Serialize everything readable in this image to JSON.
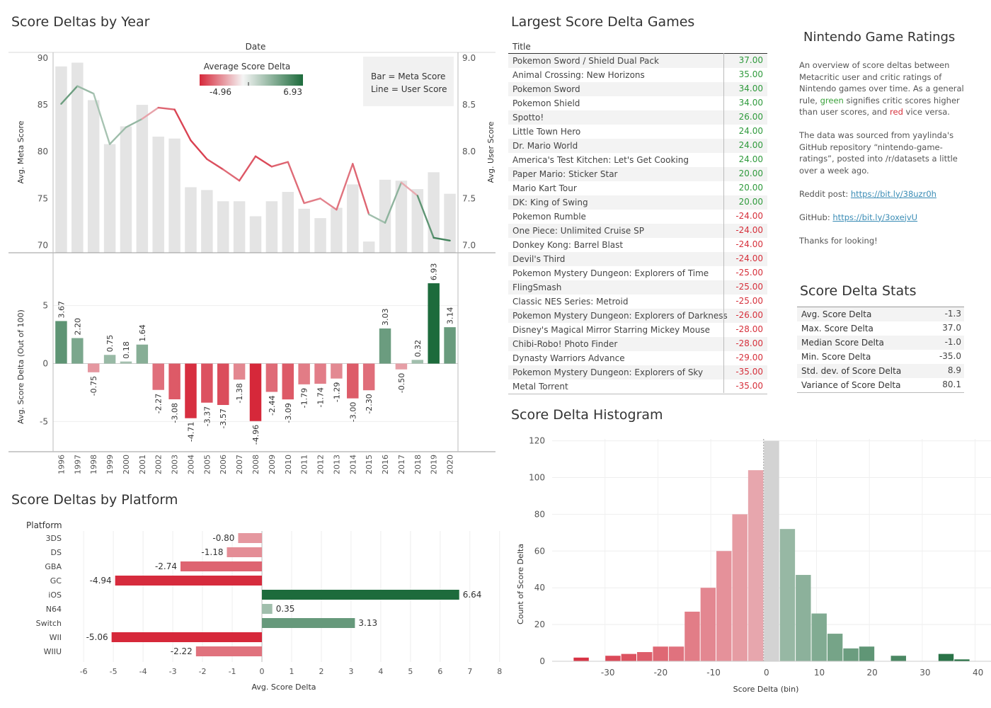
{
  "app": {
    "title": "Nintendo Game Ratings",
    "intro": {
      "p1_a": "An overview of score deltas between Metacritic user and critic ratings of Nintendo games over time. As a general rule, ",
      "p1_green": "green",
      "p1_b": " signifies critic scores higher than user scores, and ",
      "p1_red": "red",
      "p1_c": " vice versa.",
      "p2": "The data was sourced from yaylinda's GitHub repository “nintendo-game-ratings”, posted into /r/datasets a little over a week ago.",
      "reddit_label": "Reddit post: ",
      "reddit_link": "https://bit.ly/38uzr0h",
      "github_label": "GitHub: ",
      "github_link": "https://bit.ly/3oxejvU",
      "thanks": "Thanks for looking!"
    }
  },
  "titles": {
    "by_year": "Score Deltas by Year",
    "largest": "Largest Score Delta Games",
    "stats": "Score Delta Stats",
    "by_platform": "Score Deltas by Platform",
    "histogram": "Score Delta Histogram"
  },
  "colors": {
    "neg_max": "#d6283a",
    "neutral": "#f2f2f2",
    "pos_max": "#1d6b3c",
    "bar_gray": "#e4e4e4",
    "link": "#3a8cb5"
  },
  "games": {
    "header": "Title",
    "rows": [
      {
        "title": "Pokemon Sword / Shield Dual Pack",
        "value": "37.00"
      },
      {
        "title": "Animal Crossing: New Horizons",
        "value": "35.00"
      },
      {
        "title": "Pokemon Sword",
        "value": "34.00"
      },
      {
        "title": "Pokemon Shield",
        "value": "34.00"
      },
      {
        "title": "Spotto!",
        "value": "26.00"
      },
      {
        "title": "Little Town Hero",
        "value": "24.00"
      },
      {
        "title": "Dr. Mario World",
        "value": "24.00"
      },
      {
        "title": "America's Test Kitchen: Let's Get Cooking",
        "value": "24.00"
      },
      {
        "title": "Paper Mario: Sticker Star",
        "value": "20.00"
      },
      {
        "title": "Mario Kart Tour",
        "value": "20.00"
      },
      {
        "title": "DK: King of Swing",
        "value": "20.00"
      },
      {
        "title": "Pokemon Rumble",
        "value": "-24.00"
      },
      {
        "title": "One Piece: Unlimited Cruise SP",
        "value": "-24.00"
      },
      {
        "title": "Donkey Kong: Barrel Blast",
        "value": "-24.00"
      },
      {
        "title": "Devil's Third",
        "value": "-24.00"
      },
      {
        "title": "Pokemon Mystery Dungeon: Explorers of Time",
        "value": "-25.00"
      },
      {
        "title": "FlingSmash",
        "value": "-25.00"
      },
      {
        "title": "Classic NES Series: Metroid",
        "value": "-25.00"
      },
      {
        "title": "Pokemon Mystery Dungeon: Explorers of Darkness",
        "value": "-26.00"
      },
      {
        "title": "Disney's Magical Mirror Starring Mickey Mouse",
        "value": "-28.00"
      },
      {
        "title": "Chibi-Robo! Photo Finder",
        "value": "-28.00"
      },
      {
        "title": "Dynasty Warriors Advance",
        "value": "-29.00"
      },
      {
        "title": "Pokemon Mystery Dungeon: Explorers of Sky",
        "value": "-35.00"
      },
      {
        "title": "Metal Torrent",
        "value": "-35.00"
      }
    ]
  },
  "stats": {
    "rows": [
      {
        "label": "Avg. Score Delta",
        "value": "-1.3"
      },
      {
        "label": "Max. Score Delta",
        "value": "37.0"
      },
      {
        "label": "Median Score Delta",
        "value": "-1.0"
      },
      {
        "label": "Min. Score Delta",
        "value": "-35.0"
      },
      {
        "label": "Std. dev. of Score Delta",
        "value": "8.9"
      },
      {
        "label": "Variance of Score Delta",
        "value": "80.1"
      }
    ]
  },
  "chart_data": [
    {
      "id": "year_combo",
      "type": "bar",
      "title": "Score Deltas by Year",
      "header": "Date",
      "x": [
        "1996",
        "1997",
        "1998",
        "1999",
        "2000",
        "2001",
        "2002",
        "2003",
        "2004",
        "2005",
        "2006",
        "2007",
        "2008",
        "2009",
        "2010",
        "2011",
        "2012",
        "2013",
        "2014",
        "2015",
        "2016",
        "2017",
        "2018",
        "2019",
        "2020"
      ],
      "series": [
        {
          "name": "Meta Score",
          "axis": "left",
          "values": [
            89.1,
            89.5,
            85.5,
            80.8,
            82.7,
            85.0,
            81.6,
            81.4,
            76.2,
            75.9,
            74.7,
            74.7,
            73.1,
            74.7,
            75.7,
            73.9,
            72.9,
            74.0,
            76.5,
            70.4,
            77.0,
            76.9,
            76.0,
            77.8,
            75.5
          ]
        },
        {
          "name": "User Score",
          "axis": "right",
          "type": "line",
          "values": [
            8.51,
            8.7,
            8.62,
            8.08,
            8.26,
            8.35,
            8.47,
            8.45,
            8.12,
            7.92,
            7.81,
            7.69,
            7.95,
            7.84,
            7.89,
            7.45,
            7.5,
            7.38,
            7.87,
            7.33,
            7.24,
            7.67,
            7.53,
            7.08,
            7.05
          ]
        }
      ],
      "y_left": {
        "label": "Avg. Meta Score",
        "range": [
          69.2,
          90.6
        ],
        "ticks": [
          70,
          75,
          80,
          85,
          90
        ]
      },
      "y_right": {
        "label": "Avg. User Score",
        "range": [
          6.92,
          9.06
        ],
        "ticks": [
          "7.0",
          "7.5",
          "8.0",
          "8.5",
          "9.0"
        ]
      },
      "legend_title": "Average Score Delta",
      "legend_min": "-4.96",
      "legend_max": "6.93",
      "note_line1": "Bar = Meta Score",
      "note_line2": "Line = User Score"
    },
    {
      "id": "year_delta",
      "type": "bar",
      "x": [
        "1996",
        "1997",
        "1998",
        "1999",
        "2000",
        "2001",
        "2002",
        "2003",
        "2004",
        "2005",
        "2006",
        "2007",
        "2008",
        "2009",
        "2010",
        "2011",
        "2012",
        "2013",
        "2014",
        "2015",
        "2016",
        "2017",
        "2018",
        "2019",
        "2020"
      ],
      "values": [
        3.67,
        2.2,
        -0.75,
        0.75,
        0.18,
        1.64,
        -2.27,
        -3.08,
        -4.71,
        -3.37,
        -3.57,
        -1.38,
        -4.96,
        -2.44,
        -3.09,
        -1.79,
        -1.74,
        -1.29,
        -3.0,
        -2.3,
        3.03,
        -0.5,
        0.32,
        6.93,
        3.14
      ],
      "labels": [
        "3.67",
        "2.20",
        "-0.75",
        "0.75",
        "0.18",
        "1.64",
        "-2.27",
        "-3.08",
        "-4.71",
        "-3.37",
        "-3.57",
        "-1.38",
        "-4.96",
        "-2.44",
        "-3.09",
        "-1.79",
        "-1.74",
        "-1.29",
        "-3.00",
        "-2.30",
        "3.03",
        "-0.50",
        "0.32",
        "6.93",
        "3.14"
      ],
      "ylabel": "Avg. Score Delta (Out of 100)",
      "ylim": [
        -7.6,
        9.5
      ],
      "yticks": [
        -5,
        0,
        5
      ]
    },
    {
      "id": "platform",
      "type": "bar",
      "orientation": "horizontal",
      "title": "Score Deltas by Platform",
      "header": "Platform",
      "categories": [
        "3DS",
        "DS",
        "GBA",
        "GC",
        "iOS",
        "N64",
        "Switch",
        "WII",
        "WIIU"
      ],
      "values": [
        -0.8,
        -1.18,
        -2.74,
        -4.94,
        6.64,
        0.35,
        3.13,
        -5.06,
        -2.22
      ],
      "labels": [
        "-0.80",
        "-1.18",
        "-2.74",
        "-4.94",
        "6.64",
        "0.35",
        "3.13",
        "-5.06",
        "-2.22"
      ],
      "xlabel": "Avg. Score Delta",
      "xlim": [
        -6.6,
        8.1
      ],
      "xticks": [
        -6,
        -5,
        -4,
        -3,
        -2,
        -1,
        0,
        1,
        2,
        3,
        4,
        5,
        6,
        7,
        8
      ]
    },
    {
      "id": "histogram",
      "type": "bar",
      "title": "Score Delta Histogram",
      "bin_width": 3,
      "x": [
        -36,
        -30,
        -27,
        -24,
        -21,
        -18,
        -15,
        -12,
        -9,
        -6,
        -3,
        0,
        3,
        6,
        9,
        12,
        15,
        18,
        24,
        33,
        36
      ],
      "values": [
        2,
        3,
        4,
        5,
        8,
        8,
        16,
        27,
        40,
        60,
        80,
        104,
        120,
        72,
        47,
        26,
        15,
        7,
        8,
        3,
        4,
        1
      ],
      "bins": [
        {
          "x": -36,
          "count": 2
        },
        {
          "x": -30,
          "count": 3
        },
        {
          "x": -27,
          "count": 4
        },
        {
          "x": -24,
          "count": 5
        },
        {
          "x": -21,
          "count": 8
        },
        {
          "x": -18,
          "count": 8
        },
        {
          "x": -15,
          "count": 27
        },
        {
          "x": -12,
          "count": 40
        },
        {
          "x": -9,
          "count": 60
        },
        {
          "x": -6,
          "count": 80
        },
        {
          "x": -3,
          "count": 104
        },
        {
          "x": 0,
          "count": 120
        },
        {
          "x": 3,
          "count": 72
        },
        {
          "x": 6,
          "count": 47
        },
        {
          "x": 9,
          "count": 26
        },
        {
          "x": 12,
          "count": 15
        },
        {
          "x": 15,
          "count": 7
        },
        {
          "x": 18,
          "count": 8
        },
        {
          "x": 24,
          "count": 3
        },
        {
          "x": 33,
          "count": 4
        },
        {
          "x": 36,
          "count": 1
        }
      ],
      "xlabel": "Score Delta (bin)",
      "ylabel": "Count of Score Delta",
      "xlim": [
        -40,
        43
      ],
      "xticks": [
        -30,
        -20,
        -10,
        0,
        10,
        20,
        30,
        40
      ],
      "ylim": [
        0,
        121
      ],
      "yticks": [
        0,
        20,
        40,
        60,
        80,
        100,
        120
      ]
    }
  ]
}
